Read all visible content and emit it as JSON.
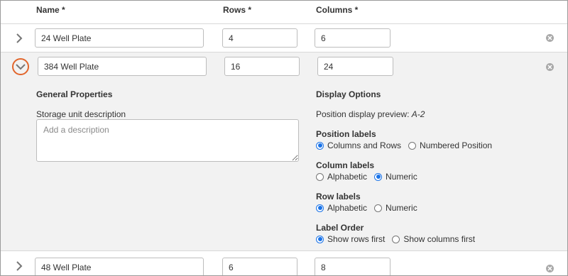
{
  "header": {
    "name": "Name *",
    "rows": "Rows *",
    "columns": "Columns *"
  },
  "rows": [
    {
      "name": "24 Well Plate",
      "rows": "4",
      "columns": "6"
    },
    {
      "name": "384 Well Plate",
      "rows": "16",
      "columns": "24"
    },
    {
      "name": "48 Well Plate",
      "rows": "6",
      "columns": "8"
    }
  ],
  "details": {
    "general_title": "General Properties",
    "desc_label": "Storage unit description",
    "desc_placeholder": "Add a description",
    "display_title": "Display Options",
    "preview_label": "Position display preview:",
    "preview_value": "A-2",
    "position_labels": {
      "label": "Position labels",
      "options": [
        "Columns and Rows",
        "Numbered Position"
      ],
      "selected": "Columns and Rows"
    },
    "column_labels": {
      "label": "Column labels",
      "options": [
        "Alphabetic",
        "Numeric"
      ],
      "selected": "Numeric"
    },
    "row_labels": {
      "label": "Row labels",
      "options": [
        "Alphabetic",
        "Numeric"
      ],
      "selected": "Alphabetic"
    },
    "label_order": {
      "label": "Label Order",
      "options": [
        "Show rows first",
        "Show columns first"
      ],
      "selected": "Show rows first"
    }
  },
  "colors": {
    "accent": "#e2652b",
    "radio": "#1a73e8",
    "expanded_bg": "#f2f2f2"
  },
  "icons": {
    "collapsed": "chevron-right-icon",
    "expanded": "chevron-down-icon",
    "remove": "close-circle-icon"
  }
}
